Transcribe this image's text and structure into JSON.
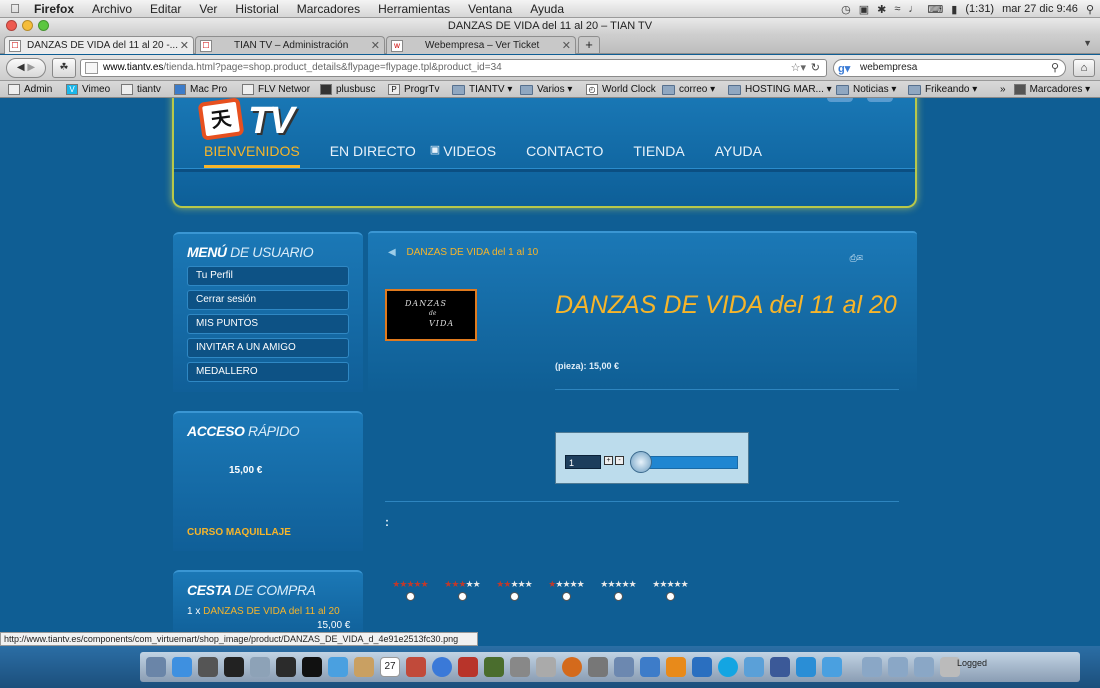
{
  "menubar": {
    "app": "Firefox",
    "items": [
      "Archivo",
      "Editar",
      "Ver",
      "Historial",
      "Marcadores",
      "Herramientas",
      "Ventana",
      "Ayuda"
    ],
    "battery": "(1:31)",
    "clock": "mar 27 dic  9:46"
  },
  "window": {
    "title": "DANZAS DE VIDA del 11 al 20 – TIAN TV"
  },
  "tabs": [
    {
      "label": "DANZAS DE VIDA del 11 al 20 -..."
    },
    {
      "label": "TIAN TV – Administración"
    },
    {
      "label": "Webempresa – Ver Ticket"
    }
  ],
  "toolbar": {
    "url_domain": "www.tiantv.es",
    "url_path": "/tienda.html?page=shop.product_details&flypage=flypage.tpl&product_id=34",
    "search_value": "webempresa"
  },
  "bookmarks": [
    {
      "label": "Admin"
    },
    {
      "label": "Vimeo"
    },
    {
      "label": "tiantv"
    },
    {
      "label": "Mac Pro"
    },
    {
      "label": "FLV Networ"
    },
    {
      "label": "plusbusc"
    },
    {
      "label": "ProgrTv"
    },
    {
      "label": "TIANTV ▾"
    },
    {
      "label": "Varios ▾"
    },
    {
      "label": "World Clock"
    },
    {
      "label": "correo ▾"
    },
    {
      "label": "HOSTING MAR... ▾"
    },
    {
      "label": "Noticias ▾"
    },
    {
      "label": "Frikeando ▾"
    },
    {
      "label": "Marcadores ▾"
    }
  ],
  "site": {
    "nav": [
      "BIENVENIDOS",
      "EN DIRECTO",
      "VIDEOS",
      "CONTACTO",
      "TIENDA",
      "AYUDA"
    ],
    "user_menu_title_bold": "MENÚ",
    "user_menu_title_thin": "DE USUARIO",
    "user_menu": [
      "Tu Perfil",
      "Cerrar sesión",
      "MIS PUNTOS",
      "INVITAR A UN AMIGO",
      "MEDALLERO"
    ],
    "quick_title_bold": "ACCESO",
    "quick_title_thin": "RÁPIDO",
    "quick_price": "15,00 €",
    "quick_link": "CURSO MAQUILLAJE",
    "cart_title_bold": "CESTA",
    "cart_title_thin": "DE COMPRA",
    "cart_qty": "1 x",
    "cart_item": "DANZAS DE VIDA del 11 al 20",
    "cart_price": "15,00 €"
  },
  "product": {
    "breadcrumb": "DANZAS DE VIDA del 1 al 10",
    "thumb_line1": "DANZAS",
    "thumb_line2": "de",
    "thumb_line3": "VIDA",
    "title": "DANZAS DE VIDA del 11 al 20",
    "price": "(pieza): 15,00 €",
    "qty": "1",
    "colon": ":",
    "ratings_red_stars": [
      5,
      3,
      2,
      1,
      0,
      0
    ]
  },
  "status": {
    "url": "http://www.tiantv.es/components/com_virtuemart/shop_image/product/DANZAS_DE_VIDA_d_4e91e2513fc30.png",
    "dock_label": "Logged"
  }
}
